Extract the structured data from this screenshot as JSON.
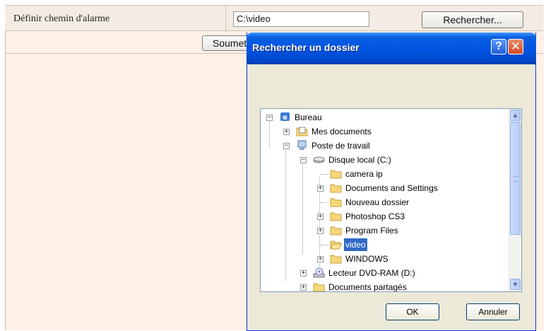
{
  "form": {
    "label": "Définir chemin d'alarme",
    "path_value": "C:\\video",
    "browse_label": "Rechercher...",
    "submit_label": "Soumettre"
  },
  "dialog": {
    "title": "Rechercher un dossier",
    "help": "?",
    "close": "✕",
    "ok_label": "OK",
    "cancel_label": "Annuler",
    "tree": [
      {
        "label": "Bureau",
        "icon": "desktop-icon",
        "expander": "−"
      },
      {
        "label": "Mes documents",
        "icon": "folder-documents-icon",
        "expander": "+"
      },
      {
        "label": "Poste de travail",
        "icon": "computer-icon",
        "expander": "−"
      },
      {
        "label": "Disque local (C:)",
        "icon": "hard-drive-icon",
        "expander": "−"
      },
      {
        "label": "camera ip",
        "icon": "folder-icon",
        "expander": ""
      },
      {
        "label": "Documents and Settings",
        "icon": "folder-icon",
        "expander": "+"
      },
      {
        "label": "Nouveau dossier",
        "icon": "folder-icon",
        "expander": ""
      },
      {
        "label": "Photoshop CS3",
        "icon": "folder-icon",
        "expander": "+"
      },
      {
        "label": "Program Files",
        "icon": "folder-icon",
        "expander": "+"
      },
      {
        "label": "video",
        "icon": "folder-open-icon",
        "expander": "",
        "selected": true
      },
      {
        "label": "WINDOWS",
        "icon": "folder-icon",
        "expander": "+"
      },
      {
        "label": "Lecteur DVD-RAM (D:)",
        "icon": "dvd-drive-icon",
        "expander": "+"
      },
      {
        "label": "Documents partagés",
        "icon": "folder-icon",
        "expander": "+"
      }
    ]
  },
  "colors": {
    "titlebar": "#0054e3",
    "selection": "#316ac5",
    "dialog_bg": "#ece9d8",
    "form_bg": "#fdf0e6"
  }
}
